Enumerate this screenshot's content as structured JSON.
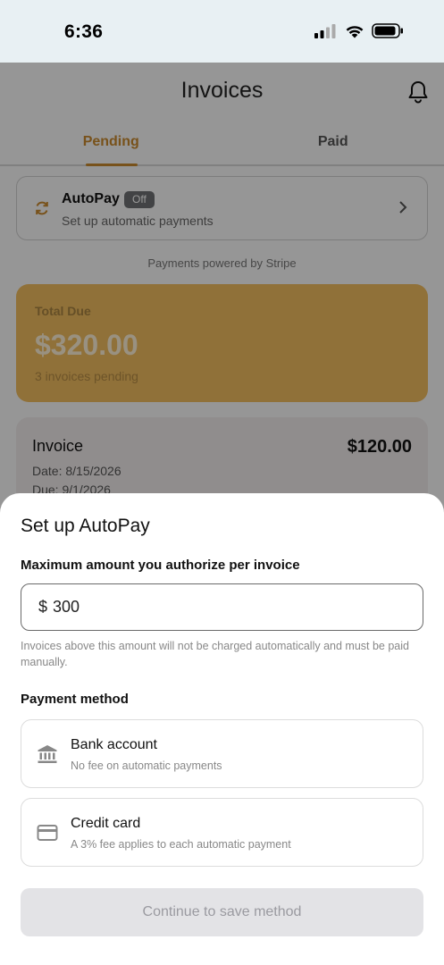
{
  "status_bar": {
    "time": "6:36"
  },
  "app": {
    "title": "Invoices",
    "tabs": [
      {
        "label": "Pending",
        "active": true
      },
      {
        "label": "Paid",
        "active": false
      }
    ],
    "autopay": {
      "title": "AutoPay",
      "badge": "Off",
      "subtitle": "Set up automatic payments"
    },
    "powered_by": "Payments powered by Stripe",
    "total": {
      "label": "Total Due",
      "amount": "$320.00",
      "subtitle": "3 invoices pending"
    },
    "invoice": {
      "title": "Invoice",
      "amount": "$120.00",
      "date": "Date: 8/15/2026",
      "due": "Due: 9/1/2026"
    }
  },
  "sheet": {
    "title": "Set up AutoPay",
    "amount_label": "Maximum amount you authorize per invoice",
    "currency_symbol": "$",
    "amount_value": "300",
    "amount_help": "Invoices above this amount will not be charged automatically and must be paid manually.",
    "payment_method_label": "Payment method",
    "methods": [
      {
        "icon": "bank-icon",
        "title": "Bank account",
        "subtitle": "No fee on automatic payments"
      },
      {
        "icon": "credit-card-icon",
        "title": "Credit card",
        "subtitle": "A 3% fee applies to each automatic payment"
      }
    ],
    "continue_label": "Continue to save method"
  },
  "colors": {
    "accent": "#c8892e",
    "total_card": "#f0bc60",
    "overlay": "rgba(0,0,0,0.4)"
  }
}
